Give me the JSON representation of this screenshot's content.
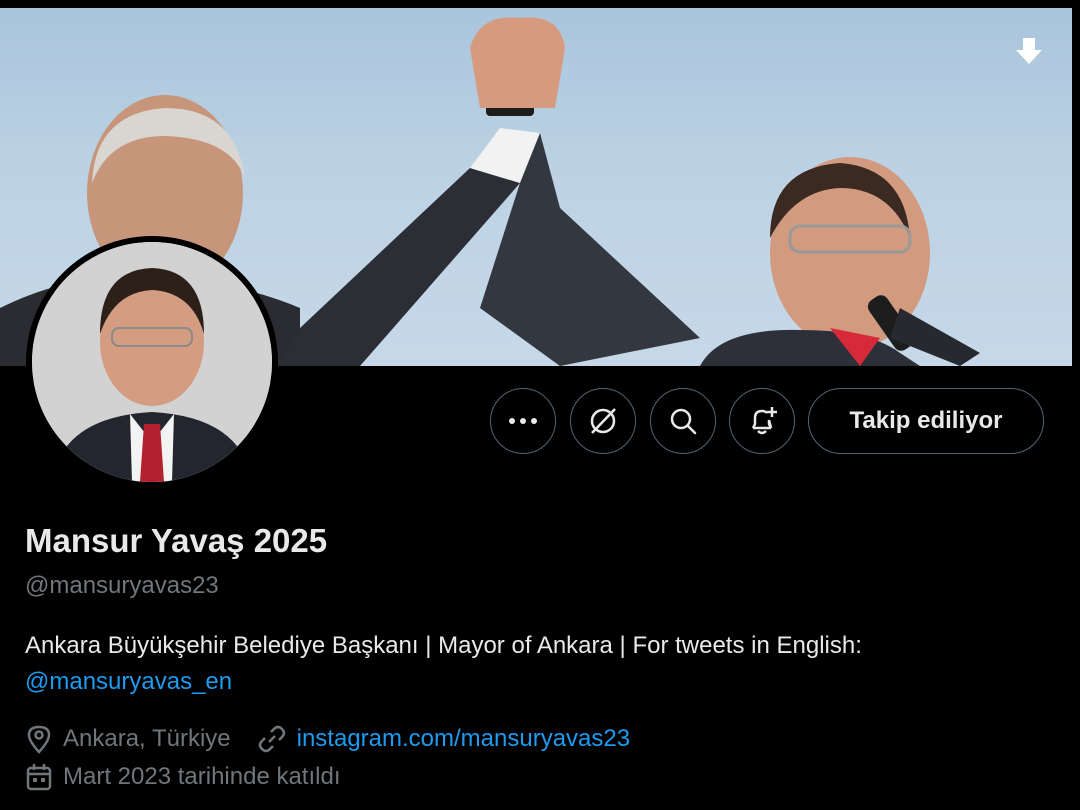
{
  "profile": {
    "display_name": "Mansur Yavaş 2025",
    "handle": "@mansuryavas23",
    "bio_text": "Ankara Büyükşehir Belediye Başkanı | Mayor of Ankara | For tweets in English:",
    "bio_mention": "@mansuryavas_en",
    "location": "Ankara, Türkiye",
    "website": "instagram.com/mansuryavas23",
    "joined": "Mart 2023 tarihinde katıldı"
  },
  "actions": {
    "follow_label": "Takip ediliyor"
  },
  "colors": {
    "background": "#000000",
    "accent": "#1d9bf0",
    "muted": "#71767b",
    "border": "#536471"
  },
  "icons": [
    "download-icon",
    "more-icon",
    "grok-icon",
    "search-icon",
    "notification-add-icon",
    "location-icon",
    "link-icon",
    "calendar-icon"
  ]
}
